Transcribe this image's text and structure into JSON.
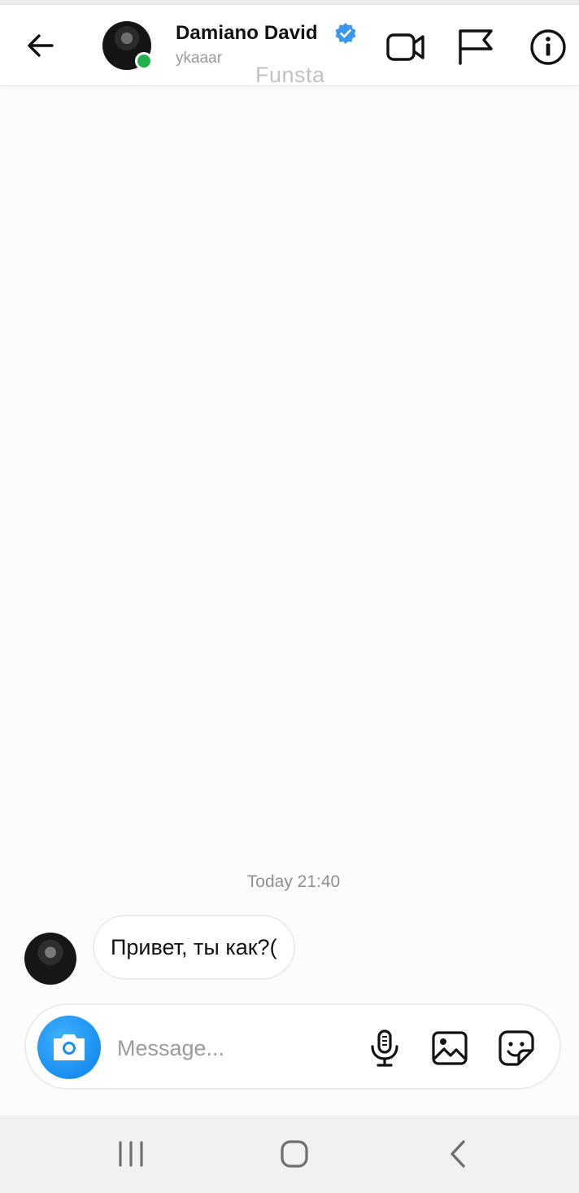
{
  "header": {
    "contact_name": "Damiano David",
    "username": "ykaaar",
    "overlay_label": "Funsta",
    "verified": true,
    "online": true,
    "icons": [
      "back-arrow-icon",
      "video-call-icon",
      "flag-icon",
      "info-icon"
    ]
  },
  "chat": {
    "timestamp": "Today 21:40",
    "messages": [
      {
        "sender": "Damiano David",
        "text": "Привет, ты как?("
      }
    ]
  },
  "composer": {
    "placeholder": "Message...",
    "value": "",
    "icons": [
      "camera-icon",
      "microphone-icon",
      "gallery-icon",
      "sticker-icon"
    ]
  },
  "system_nav": {
    "buttons": [
      "recents-icon",
      "home-icon",
      "back-icon"
    ]
  },
  "colors": {
    "accent_blue": "#1a8ff0",
    "online_green": "#22b14c",
    "verified_blue": "#3897f0",
    "muted_text": "#9a9a9a"
  }
}
